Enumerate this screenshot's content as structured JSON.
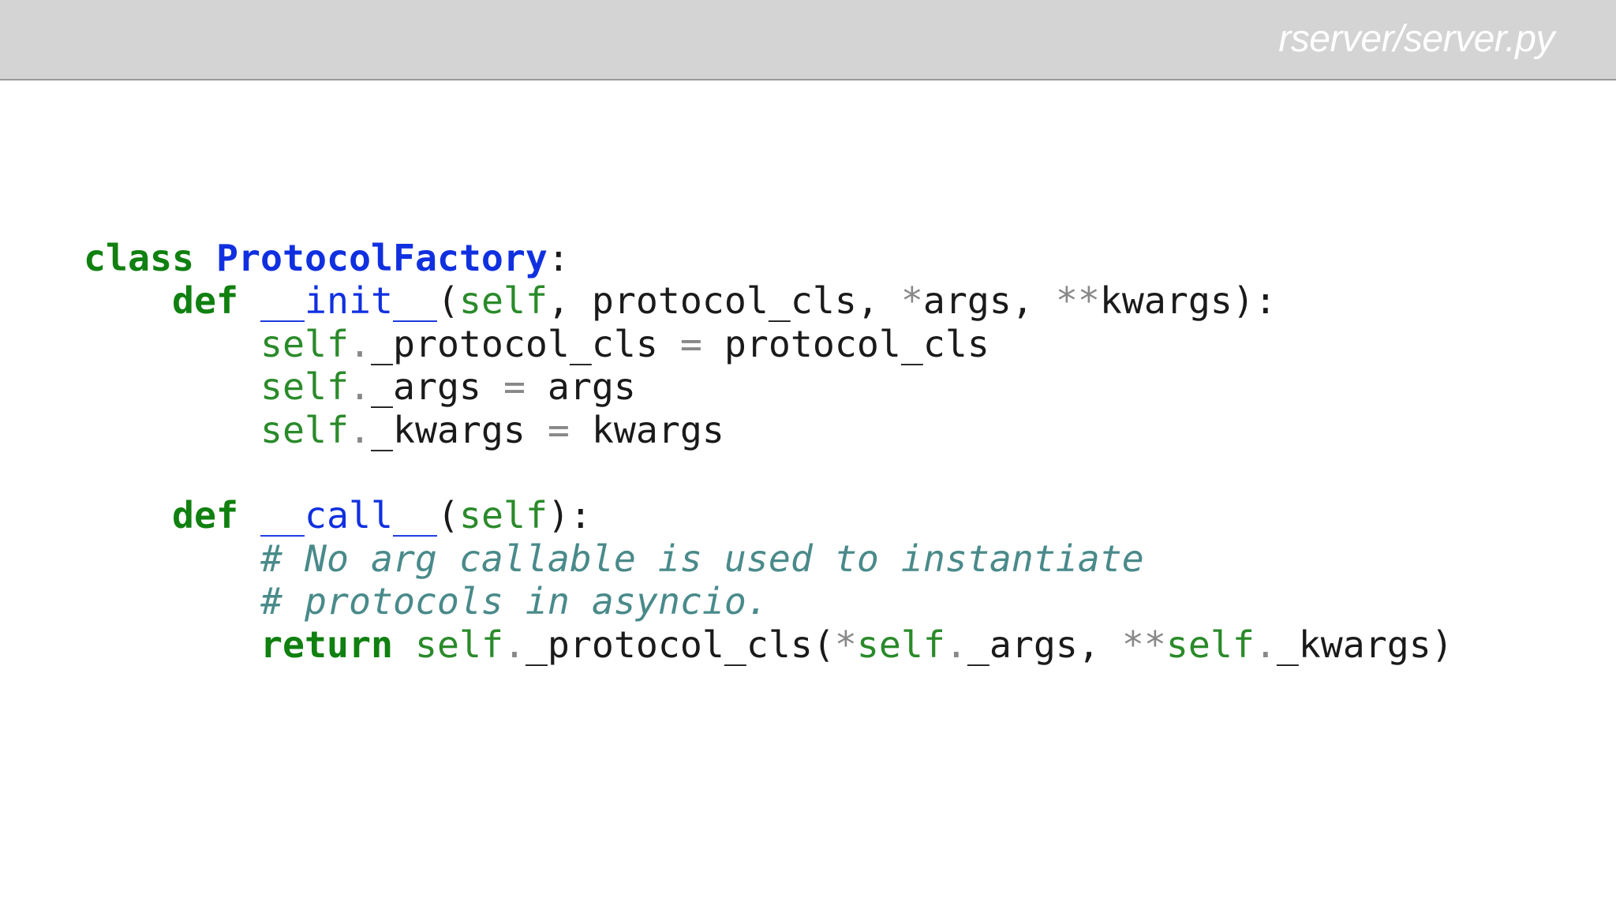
{
  "header": {
    "file_path": "rserver/server.py"
  },
  "colors": {
    "header_background": "#d4d4d4",
    "keyword": "#108010",
    "class_name": "#1030e0",
    "function_name": "#1030e0",
    "self": "#2a8a2a",
    "operator": "#888888",
    "comment": "#4a8a8a",
    "text": "#1a1a1a"
  },
  "code": {
    "language": "python",
    "lines": [
      [
        {
          "t": "class",
          "c": "kw"
        },
        {
          "t": " ",
          "c": "txt"
        },
        {
          "t": "ProtocolFactory",
          "c": "cls"
        },
        {
          "t": ":",
          "c": "txt"
        }
      ],
      [
        {
          "t": "    ",
          "c": "txt"
        },
        {
          "t": "def",
          "c": "kw"
        },
        {
          "t": " ",
          "c": "txt"
        },
        {
          "t": "__init__",
          "c": "fn"
        },
        {
          "t": "(",
          "c": "txt"
        },
        {
          "t": "self",
          "c": "self"
        },
        {
          "t": ", protocol_cls, ",
          "c": "txt"
        },
        {
          "t": "*",
          "c": "op"
        },
        {
          "t": "args, ",
          "c": "txt"
        },
        {
          "t": "**",
          "c": "op"
        },
        {
          "t": "kwargs):",
          "c": "txt"
        }
      ],
      [
        {
          "t": "        ",
          "c": "txt"
        },
        {
          "t": "self",
          "c": "self"
        },
        {
          "t": ".",
          "c": "op"
        },
        {
          "t": "_protocol_cls ",
          "c": "txt"
        },
        {
          "t": "=",
          "c": "op"
        },
        {
          "t": " protocol_cls",
          "c": "txt"
        }
      ],
      [
        {
          "t": "        ",
          "c": "txt"
        },
        {
          "t": "self",
          "c": "self"
        },
        {
          "t": ".",
          "c": "op"
        },
        {
          "t": "_args ",
          "c": "txt"
        },
        {
          "t": "=",
          "c": "op"
        },
        {
          "t": " args",
          "c": "txt"
        }
      ],
      [
        {
          "t": "        ",
          "c": "txt"
        },
        {
          "t": "self",
          "c": "self"
        },
        {
          "t": ".",
          "c": "op"
        },
        {
          "t": "_kwargs ",
          "c": "txt"
        },
        {
          "t": "=",
          "c": "op"
        },
        {
          "t": " kwargs",
          "c": "txt"
        }
      ],
      [],
      [
        {
          "t": "    ",
          "c": "txt"
        },
        {
          "t": "def",
          "c": "kw"
        },
        {
          "t": " ",
          "c": "txt"
        },
        {
          "t": "__call__",
          "c": "fn"
        },
        {
          "t": "(",
          "c": "txt"
        },
        {
          "t": "self",
          "c": "self"
        },
        {
          "t": "):",
          "c": "txt"
        }
      ],
      [
        {
          "t": "        ",
          "c": "txt"
        },
        {
          "t": "# No arg callable is used to instantiate",
          "c": "cm"
        }
      ],
      [
        {
          "t": "        ",
          "c": "txt"
        },
        {
          "t": "# protocols in asyncio.",
          "c": "cm"
        }
      ],
      [
        {
          "t": "        ",
          "c": "txt"
        },
        {
          "t": "return",
          "c": "kw"
        },
        {
          "t": " ",
          "c": "txt"
        },
        {
          "t": "self",
          "c": "self"
        },
        {
          "t": ".",
          "c": "op"
        },
        {
          "t": "_protocol_cls(",
          "c": "txt"
        },
        {
          "t": "*",
          "c": "op"
        },
        {
          "t": "self",
          "c": "self"
        },
        {
          "t": ".",
          "c": "op"
        },
        {
          "t": "_args, ",
          "c": "txt"
        },
        {
          "t": "**",
          "c": "op"
        },
        {
          "t": "self",
          "c": "self"
        },
        {
          "t": ".",
          "c": "op"
        },
        {
          "t": "_kwargs)",
          "c": "txt"
        }
      ]
    ]
  }
}
